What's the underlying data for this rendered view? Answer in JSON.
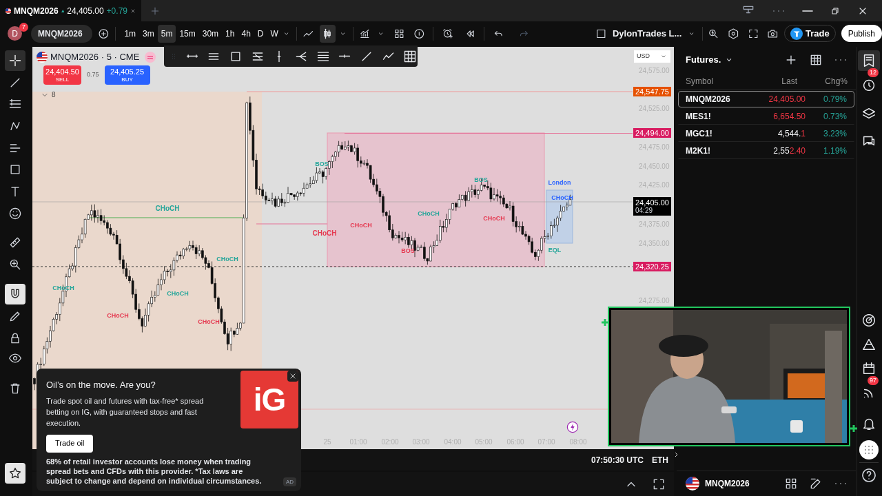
{
  "tab": {
    "symbol": "MNQM2026",
    "price": "24,405.00",
    "change": "+0.79"
  },
  "header": {
    "avatar": "D",
    "avatar_badge": "7",
    "symbol": "MNQM2026",
    "layout_name": "DylonTrades L...",
    "trade": "Trade",
    "publish": "Publish",
    "intervals": [
      {
        "label": "1m",
        "selected": false
      },
      {
        "label": "3m",
        "selected": false
      },
      {
        "label": "5m",
        "selected": true
      },
      {
        "label": "15m",
        "selected": false
      },
      {
        "label": "30m",
        "selected": false
      },
      {
        "label": "1h",
        "selected": false
      },
      {
        "label": "4h",
        "selected": false
      },
      {
        "label": "D",
        "selected": false
      },
      {
        "label": "W",
        "selected": false
      }
    ]
  },
  "tools": [
    {
      "kind": "crosshair",
      "selected": true
    },
    {
      "kind": "trendline",
      "selected": false
    },
    {
      "kind": "fib",
      "selected": false
    },
    {
      "kind": "pattern",
      "selected": false
    },
    {
      "kind": "forecast",
      "selected": false
    },
    {
      "kind": "shapes",
      "selected": false
    },
    {
      "kind": "text",
      "selected": false
    },
    {
      "kind": "emoji",
      "selected": false
    },
    {
      "kind": "ruler",
      "selected": false
    },
    {
      "kind": "zoom",
      "selected": false
    },
    {
      "kind": "magnet",
      "selected": true
    },
    {
      "kind": "pencil",
      "selected": false
    },
    {
      "kind": "lock",
      "selected": false
    },
    {
      "kind": "eye",
      "selected": false
    },
    {
      "kind": "trash",
      "selected": false
    },
    {
      "kind": "star",
      "selected": true
    }
  ],
  "chart": {
    "legend": "MNQM2026 · 5 · CME",
    "sell_price": "24,404.50",
    "sell_label": "SELL",
    "spread": "0.75",
    "buy_price": "24,405.25",
    "buy_label": "BUY",
    "indicator_count": "8",
    "currency": "USD",
    "price_ticks": [
      "24,575.00",
      "24,525.00",
      "24,475.00",
      "24,450.00",
      "24,425.00",
      "24,375.00",
      "24,350.00",
      "24,275.00"
    ],
    "price_tags": [
      {
        "value": "24,547.75",
        "color": "#e65100"
      },
      {
        "value": "24,494.00",
        "color": "#d81b60"
      },
      {
        "value": "24,320.25",
        "color": "#d81b60"
      }
    ],
    "current_price": "24,405.00",
    "countdown": "04:29",
    "time_ticks": [
      "25",
      "01:00",
      "02:00",
      "03:00",
      "04:00",
      "05:00",
      "06:00",
      "07:00",
      "08:00"
    ],
    "annotations": [
      {
        "text": "CHoCH",
        "color": "#26a69a"
      },
      {
        "text": "CHoCH",
        "color": "#26a69a"
      },
      {
        "text": "CHoCH",
        "color": "#26a69a"
      },
      {
        "text": "CHoCH",
        "color": "#26a69a"
      },
      {
        "text": "CHoCH",
        "color": "#e53950"
      },
      {
        "text": "CHoCH",
        "color": "#e53950"
      },
      {
        "text": "CHoCH",
        "color": "#e53950"
      },
      {
        "text": "BOS",
        "color": "#26a69a"
      },
      {
        "text": "BOS",
        "color": "#26a69a"
      },
      {
        "text": "CHoCH",
        "color": "#26a69a"
      },
      {
        "text": "CHoCH",
        "color": "#e53950"
      },
      {
        "text": "BOS",
        "color": "#e53950"
      },
      {
        "text": "London",
        "color": "#2962ff"
      },
      {
        "text": "EQL",
        "color": "#26a69a"
      },
      {
        "text": "CHoCH",
        "color": "#e53950"
      },
      {
        "text": "CHoCH",
        "color": "#2962ff"
      }
    ]
  },
  "status": {
    "time": "07:50:30 UTC",
    "session": "ETH"
  },
  "watchlist": {
    "title": "Futures.",
    "columns": [
      "Symbol",
      "Last",
      "Chg%"
    ],
    "rows": [
      {
        "symbol": "MNQM2026",
        "last_changed": "24,405.00",
        "change": "0.79%",
        "selected": true
      },
      {
        "symbol": "MES1!",
        "last_changed": "6,654.50",
        "change": "0.73%",
        "selected": false
      },
      {
        "symbol": "MGC1!",
        "last_plain": "4,544.",
        "last_changed": "1",
        "change": "3.23%",
        "selected": false
      },
      {
        "symbol": "M2K1!",
        "last_plain": "2,55",
        "last_changed": "2.40",
        "change": "1.19%",
        "selected": false
      }
    ]
  },
  "side_badges": {
    "alerts": "12",
    "broadcast": "97"
  },
  "ad": {
    "headline": "Oil’s on the move. Are you?",
    "body": "Trade spot oil and futures with tax-free* spread betting on IG, with guaranteed stops and fast execution.",
    "button": "Trade oil",
    "disclaimer": "68% of retail investor accounts lose money when trading spread bets and CFDs with this provider. *Tax laws are subject to change and depend on individual circumstances.",
    "logo": "iG",
    "badge": "AD"
  },
  "footer": {
    "symbol": "MNQM2026"
  }
}
